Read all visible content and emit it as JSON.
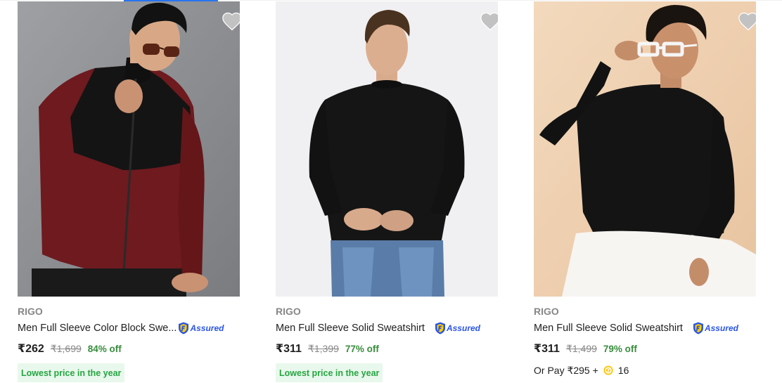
{
  "colors": {
    "assured_blue": "#2a55e5",
    "discount_green": "#388e3c",
    "badge_bg": "#e8f8ec",
    "badge_text": "#26a541",
    "muted_gray": "#878787"
  },
  "products": [
    {
      "brand": "RIGO",
      "title": "Men Full Sleeve Color Block Swe...",
      "assured_label": "Assured",
      "price": "₹262",
      "mrp": "₹1,699",
      "discount": "84% off",
      "badge": "Lowest price in the year",
      "wishlist_icon": "heart-icon"
    },
    {
      "brand": "RIGO",
      "title": "Men Full Sleeve Solid Sweatshirt",
      "assured_label": "Assured",
      "price": "₹311",
      "mrp": "₹1,399",
      "discount": "77% off",
      "badge": "Lowest price in the year",
      "wishlist_icon": "heart-icon"
    },
    {
      "brand": "RIGO",
      "title": "Men Full Sleeve Solid Sweatshirt",
      "assured_label": "Assured",
      "price": "₹311",
      "mrp": "₹1,499",
      "discount": "79% off",
      "or_pay": "Or Pay ₹295 +",
      "coins": "16",
      "wishlist_icon": "heart-icon"
    }
  ]
}
